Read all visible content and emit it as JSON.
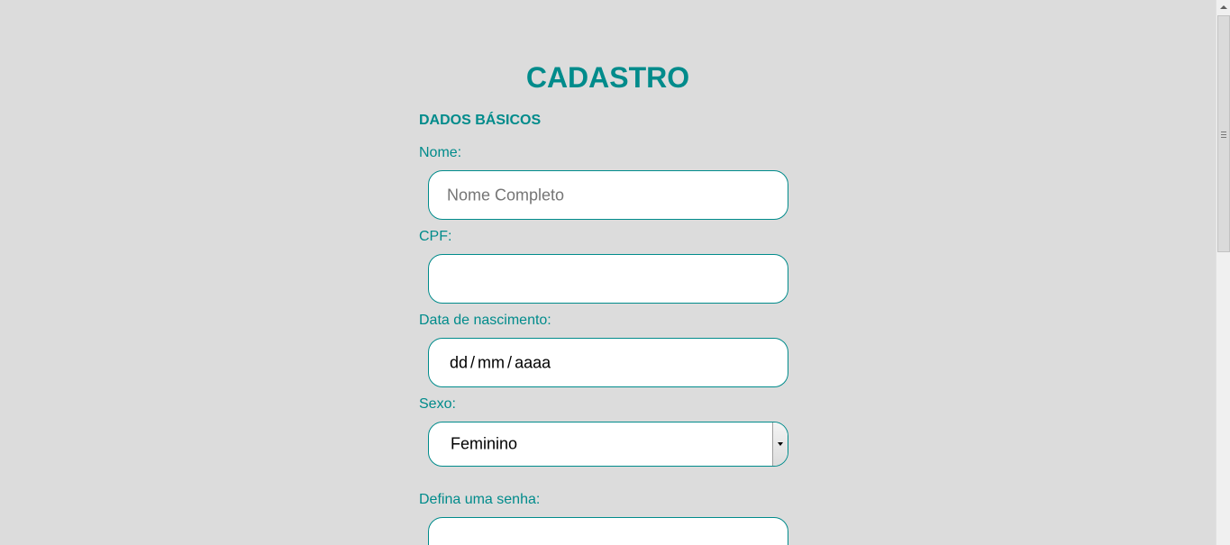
{
  "page": {
    "title": "CADASTRO",
    "section_title": "DADOS BÁSICOS"
  },
  "form": {
    "nome": {
      "label": "Nome:",
      "value": "",
      "placeholder": "Nome Completo"
    },
    "cpf": {
      "label": "CPF:",
      "value": ""
    },
    "data_nascimento": {
      "label": "Data de nascimento:",
      "day_placeholder": "dd",
      "month_placeholder": "mm",
      "year_placeholder": "aaaa",
      "separator": "/"
    },
    "sexo": {
      "label": "Sexo:",
      "selected": "Feminino"
    },
    "senha": {
      "label": "Defina uma senha:",
      "value": ""
    }
  },
  "colors": {
    "accent": "#008b8b",
    "background": "#dcdcdc",
    "field_background": "#ffffff"
  }
}
